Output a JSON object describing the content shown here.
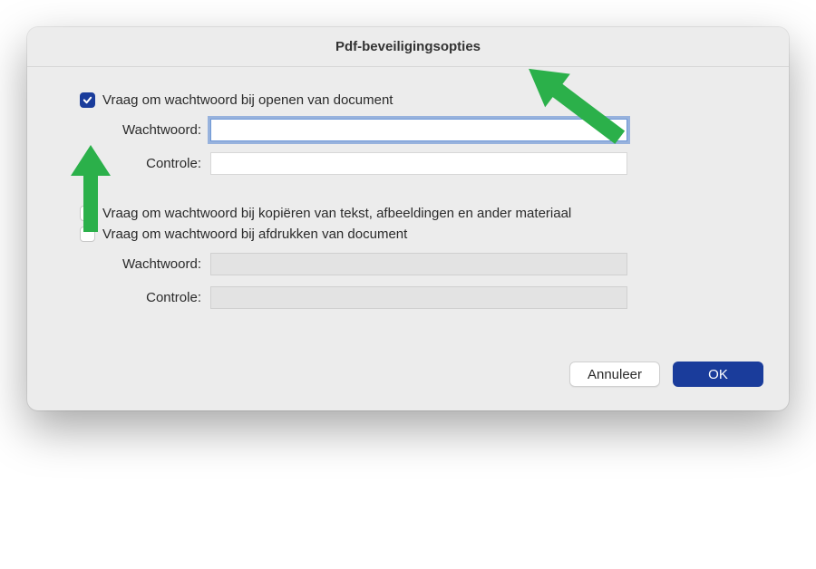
{
  "dialog": {
    "title": "Pdf-beveiligingsopties"
  },
  "section_open": {
    "checkbox_label": "Vraag om wachtwoord bij openen van document",
    "checked": true,
    "password_label": "Wachtwoord:",
    "password_value": "",
    "verify_label": "Controle:",
    "verify_value": ""
  },
  "section_restrict": {
    "checkbox_copy_label": "Vraag om wachtwoord bij kopiëren van tekst, afbeeldingen en ander materiaal",
    "checkbox_copy_checked": false,
    "checkbox_print_label": "Vraag om wachtwoord bij afdrukken van document",
    "checkbox_print_checked": false,
    "password_label": "Wachtwoord:",
    "password_value": "",
    "verify_label": "Controle:",
    "verify_value": ""
  },
  "buttons": {
    "cancel": "Annuleer",
    "ok": "OK"
  },
  "annotations": {
    "arrow_to_checkbox": "arrow-up-icon",
    "arrow_to_field": "arrow-down-left-icon",
    "color": "#2bb04a"
  }
}
